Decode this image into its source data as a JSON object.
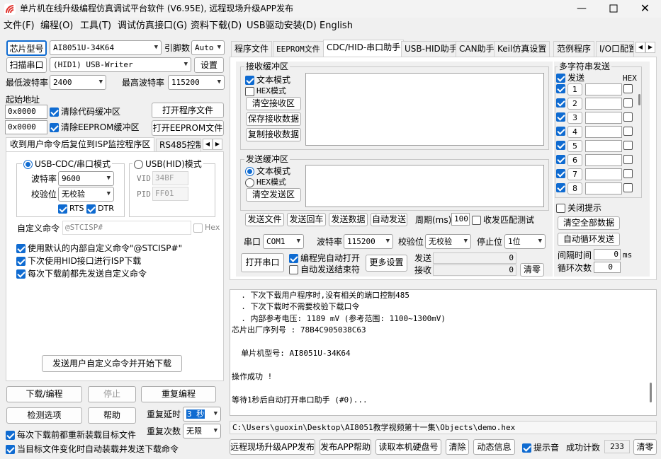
{
  "window": {
    "title": "单片机在线升级编程仿真调试平台软件 (V6.95E), 远程现场升级APP发布",
    "controls": [
      "minimize-icon",
      "maximize-icon",
      "close-icon"
    ]
  },
  "menu": [
    "文件(F)",
    "编程(O)",
    "工具(T)",
    "调试仿真接口(G)",
    "资料下载(D)",
    "USB驱动安装(D)",
    "English"
  ],
  "left": {
    "chip_button": "芯片型号",
    "chip_value": "AI8051U-34K64",
    "pins_label": "引脚数",
    "pins_value": "Auto",
    "scan_button": "扫描串口",
    "port_value": "(HID1) USB-Writer",
    "settings_button": "设置",
    "min_baud_label": "最低波特率",
    "min_baud_value": "2400",
    "max_baud_label": "最高波特率",
    "max_baud_value": "115200",
    "start_addr_label": "起始地址",
    "addr1": "0x0000",
    "clear_code_label": "清除代码缓冲区",
    "open_prog_button": "打开程序文件",
    "addr2": "0x0000",
    "clear_eeprom_label": "清除EEPROM缓冲区",
    "open_eeprom_button": "打开EEPROM文件",
    "subtabs": [
      "收到用户命令后复位到ISP监控程序区",
      "RS485控制"
    ],
    "cdc_mode": "USB-CDC/串口模式",
    "hid_mode": "USB(HID)模式",
    "baud_label": "波特率",
    "baud_value": "9600",
    "parity_label": "校验位",
    "parity_value": "无校验",
    "rts_label": "RTS",
    "dtr_label": "DTR",
    "vid_label": "VID",
    "vid_value": "34BF",
    "pid_label": "PID",
    "pid_value": "FF01",
    "custom_cmd_label": "自定义命令",
    "custom_cmd_value": "@STCISP#",
    "hex_label": "Hex",
    "opt1": "使用默认的内部自定义命令\"@STCISP#\"",
    "opt2": "下次使用HID接口进行ISP下载",
    "opt3": "每次下载前都先发送自定义命令",
    "send_custom_button": "发送用户自定义命令并开始下载",
    "download_button": "下载/编程",
    "stop_button": "停止",
    "reprogram_button": "重复编程",
    "check_button": "检测选项",
    "help_button": "帮助",
    "repeat_delay_label": "重复延时",
    "repeat_delay_value": "3 秒",
    "repeat_count_label": "重复次数",
    "repeat_count_value": "无限",
    "reload_label": "每次下载前都重新装载目标文件",
    "autosend_label": "当目标文件变化时自动装载并发送下载命令"
  },
  "tabs": [
    "程序文件",
    "EEPROM文件",
    "CDC/HID-串口助手",
    "USB-HID助手",
    "CAN助手",
    "Keil仿真设置",
    "范例程序",
    "I/O口配置"
  ],
  "active_tab": 2,
  "serial": {
    "recv_title": "接收缓冲区",
    "text_mode": "文本模式",
    "hex_mode": "HEX模式",
    "clear_recv": "清空接收区",
    "save_recv": "保存接收数据",
    "copy_recv": "复制接收数据",
    "send_title": "发送缓冲区",
    "send_text_mode": "文本模式",
    "send_hex_mode": "HEX模式",
    "clear_send": "清空发送区",
    "send_file": "发送文件",
    "send_enter": "发送回车",
    "send_data": "发送数据",
    "auto_send": "自动发送",
    "period_label": "周期(ms)",
    "period_value": "100",
    "match_label": "收发匹配测试",
    "port_label": "串口",
    "port_value": "COM1",
    "baud_label": "波特率",
    "baud_value": "115200",
    "parity_label": "校验位",
    "parity_value": "无校验",
    "stop_label": "停止位",
    "stop_value": "1位",
    "open_port": "打开串口",
    "auto_open": "编程完自动打开",
    "auto_send_end": "自动发送结束符",
    "more_settings": "更多设置",
    "tx_label": "发送",
    "tx_value": "0",
    "rx_label": "接收",
    "rx_value": "0",
    "clear_count": "清零",
    "multi_title": "多字符串发送",
    "multi_send_header": "发送",
    "multi_hex_header": "HEX",
    "multi_rows": [
      "1",
      "2",
      "3",
      "4",
      "5",
      "6",
      "7",
      "8"
    ],
    "close_hint": "关闭提示",
    "clear_all": "清空全部数据",
    "auto_loop": "自动循环发送",
    "interval_label": "间隔时间",
    "interval_value": "0",
    "interval_unit": "ms",
    "loop_label": "循环次数",
    "loop_value": "0"
  },
  "log": [
    "  . 下次下载用户程序时,没有相关的端口控制485",
    "  . 下次下载时不需要校验下载口令",
    "  . 内部参考电压: 1189 mV (参考范围: 1100~1300mV)",
    "芯片出厂序列号 : 78B4C905038C63",
    "",
    "  单片机型号: AI8051U-34K64",
    "",
    "操作成功 !",
    "",
    "等待1秒后自动打开串口助手 (#0)..."
  ],
  "path": "C:\\Users\\guoxin\\Desktop\\AI8051教学视频第十一集\\Objects\\demo.hex",
  "bottom": {
    "remote_publish": "远程现场升级APP发布",
    "publish_help": "发布APP帮助",
    "read_disk": "读取本机硬盘号",
    "clear": "清除",
    "dynamic_info": "动态信息",
    "beep_label": "提示音",
    "success_label": "成功计数",
    "success_value": "233",
    "clear_count": "清零"
  }
}
